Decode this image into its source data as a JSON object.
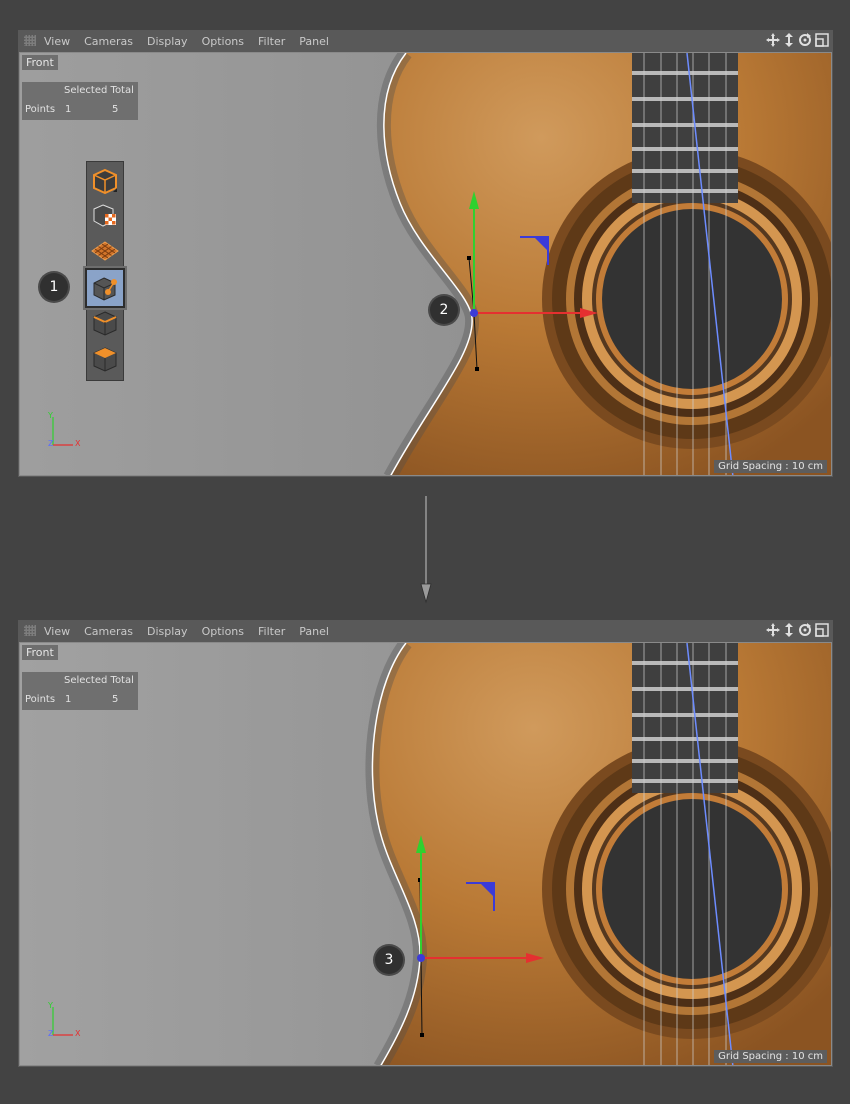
{
  "menu": {
    "view": "View",
    "cameras": "Cameras",
    "display": "Display",
    "options": "Options",
    "filter": "Filter",
    "panel": "Panel"
  },
  "viewport": {
    "label": "Front",
    "grid_spacing": "Grid Spacing : 10 cm"
  },
  "hud": {
    "header": "Selected Total",
    "row_label": "Points",
    "selected": "1",
    "total": "5"
  },
  "axis_labels": {
    "x": "X",
    "y": "Y",
    "z": "Z"
  },
  "callouts": {
    "one": "1",
    "two": "2",
    "three": "3"
  },
  "toolbar": {
    "tools": [
      "model-mode",
      "texture-mode",
      "workplane-mode",
      "points-mode",
      "edges-mode",
      "polygons-mode"
    ],
    "active_tool": "points-mode"
  },
  "icons": {
    "move": "move-icon",
    "scroll": "scroll-icon",
    "rotate": "rotate-icon",
    "maximize": "maximize-icon"
  },
  "colors": {
    "x_axis": "#e53030",
    "y_axis": "#2fd12f",
    "handle": "#3b3bd8",
    "spline": "#ffffff",
    "string_line": "#6d8cff"
  }
}
